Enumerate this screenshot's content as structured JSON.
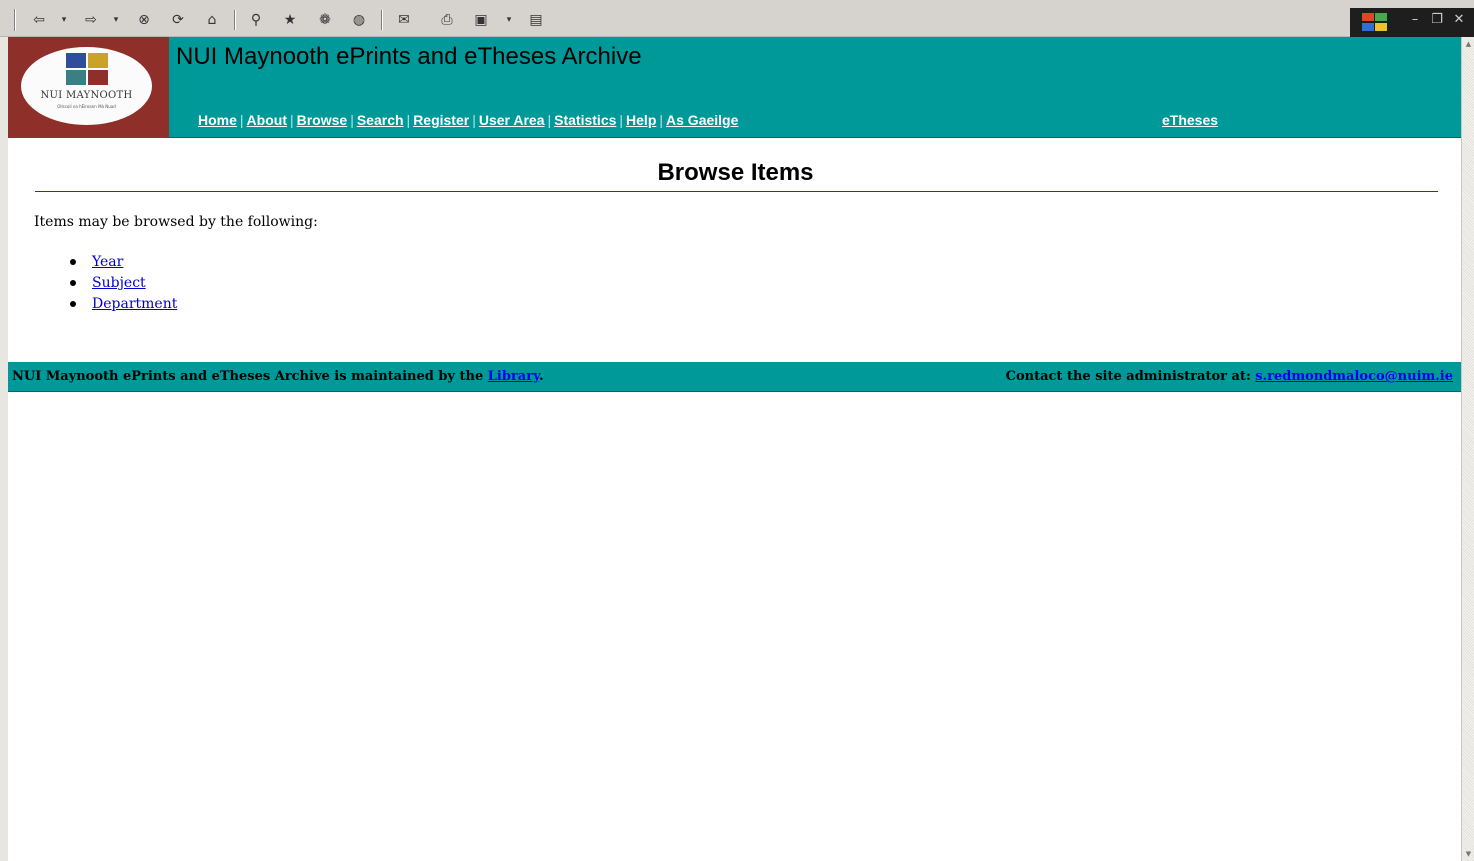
{
  "toolbar": {
    "buttons": [
      {
        "name": "back-button",
        "glyph": "⇦"
      },
      {
        "name": "back-dropdown",
        "glyph": "▾"
      },
      {
        "name": "forward-button",
        "glyph": "⇨"
      },
      {
        "name": "forward-dropdown",
        "glyph": "▾"
      },
      {
        "name": "stop-button",
        "glyph": "⊗"
      },
      {
        "name": "refresh-button",
        "glyph": "⟳"
      },
      {
        "name": "home-button",
        "glyph": "⌂"
      },
      {
        "name": "search-button",
        "glyph": "⚲"
      },
      {
        "name": "favorites-button",
        "glyph": "★"
      },
      {
        "name": "history-button",
        "glyph": "❁"
      },
      {
        "name": "channels-button",
        "glyph": "◍"
      },
      {
        "name": "mail-button",
        "glyph": "✉"
      },
      {
        "name": "print-button",
        "glyph": "⎙"
      },
      {
        "name": "edit-button",
        "glyph": "▣"
      },
      {
        "name": "discuss-button",
        "glyph": "▤"
      }
    ]
  },
  "header": {
    "logo_text": "NUI MAYNOOTH",
    "logo_tagline": "Ollscoil na hÉireann Má Nuad",
    "site_title": "NUI Maynooth ePrints and eTheses Archive",
    "nav": [
      {
        "label": "Home"
      },
      {
        "label": "About"
      },
      {
        "label": "Browse"
      },
      {
        "label": "Search"
      },
      {
        "label": "Register"
      },
      {
        "label": "User Area"
      },
      {
        "label": "Statistics"
      },
      {
        "label": "Help"
      },
      {
        "label": "As Gaeilge"
      }
    ],
    "etheses_label": "eTheses",
    "nav_separator": "|"
  },
  "main": {
    "title": "Browse Items",
    "intro": "Items may be browsed by the following:",
    "links": [
      {
        "label": "Year"
      },
      {
        "label": "Subject"
      },
      {
        "label": "Department"
      }
    ]
  },
  "footer": {
    "left_text": "NUI Maynooth ePrints and eTheses Archive is maintained by the ",
    "left_link": "Library",
    "left_suffix": ".",
    "right_text": "Contact the site administrator at: ",
    "right_link": "s.redmondmaloco@nuim.ie"
  },
  "colors": {
    "header_bg": "#009999",
    "logo_bg": "#8e2f2a",
    "rule": "#8b1a1a",
    "link": "#0000cc"
  }
}
